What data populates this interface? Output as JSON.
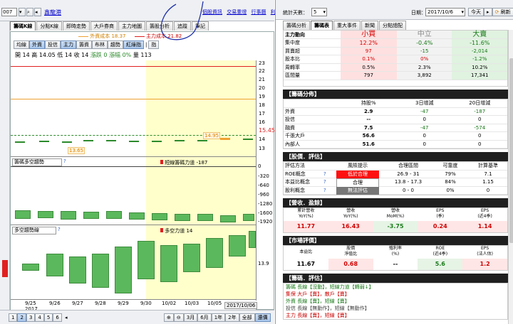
{
  "top_left": {
    "code": "007",
    "stock_name": "鑫龍港"
  },
  "chart_tabs": [
    "籌碼K線",
    "分點K線",
    "即時走勢",
    "大戶券商",
    "主力地圖",
    "籌股分析",
    "追蹤",
    "筆記"
  ],
  "header_links": [
    "個股資訊",
    "交易重燈",
    "行事曆",
    "利費通知"
  ],
  "avg_legend": {
    "foreign": "外資成本 18.37",
    "main": "主力成本 21.82"
  },
  "toolbar": [
    "均線",
    "外資",
    "投信",
    "主力",
    "籌資",
    "布林",
    "趨勢",
    "紅綠指",
    "|",
    "指"
  ],
  "ohlc": {
    "open": "開 14",
    "high": "高 14.05",
    "low": "低 14",
    "close": "收 14",
    "change": "漲跌 0",
    "pct": "漲幅 0%",
    "vol": "量 113"
  },
  "price_axis": {
    "ticks": [
      "23",
      "22",
      "21",
      "20",
      "19",
      "18",
      "17",
      "16",
      "15",
      "14",
      "13"
    ],
    "current": "15.45"
  },
  "candle_labels": {
    "high": "14.95",
    "low": "13.65"
  },
  "panel2": {
    "name": "籌碼多空趨勢",
    "legend": "短線籌碼力道 -187",
    "ticks": [
      "0",
      "-320",
      "-640",
      "-960",
      "-1280",
      "-1600",
      "-1920"
    ]
  },
  "panel3": {
    "name": "多空趨勢線",
    "legend": "多空力道 14",
    "ticks": [
      "13.9"
    ]
  },
  "x_axis": {
    "labels": [
      "9/25",
      "9/26",
      "9/27",
      "9/28",
      "9/29",
      "9/30",
      "10/02",
      "10/03",
      "10/05"
    ],
    "year": "2017",
    "selected_date": "2017/10/06"
  },
  "bottom_bar": {
    "pages": [
      "1",
      "2",
      "3",
      "4",
      "5",
      "6"
    ],
    "ranges": [
      "3月",
      "6月",
      "1年",
      "2年",
      "全部",
      "還價"
    ]
  },
  "right_top": {
    "stats_label": "統計天數：",
    "stats_value": "5",
    "date_label": "日期：",
    "date_value": "2017/10/6",
    "today_btn": "今天",
    "refresh_btn": "刷新"
  },
  "right_tabs": [
    "籌碼分析",
    "籌碼表",
    "重大事件",
    "新聞",
    "分點總配"
  ],
  "summary": {
    "cols": [
      "小買",
      "中立",
      "大賣"
    ],
    "rows": [
      {
        "label": "主力動向",
        "v": [
          "小買",
          "中立",
          "大賣"
        ]
      },
      {
        "label": "集中度",
        "v": [
          "12.2%",
          "-0.4%",
          "-11.6%"
        ]
      },
      {
        "label": "買賣超",
        "v": [
          "97",
          "-15",
          "-2,014"
        ]
      },
      {
        "label": "股本比",
        "v": [
          "0.1%",
          "0%",
          "-1.2%"
        ]
      },
      {
        "label": "周轉率",
        "v": [
          "0.5%",
          "2.3%",
          "10.2%"
        ]
      },
      {
        "label": "區間量",
        "v": [
          "797",
          "3,892",
          "17,341"
        ]
      }
    ]
  },
  "dist": {
    "title": "【籌碼分佈】",
    "head": [
      "",
      "持股%",
      "3日增減",
      "20日增減"
    ],
    "rows": [
      [
        "外資",
        "2.9",
        "-47",
        "-187"
      ],
      [
        "投信",
        "--",
        "0",
        "0"
      ],
      [
        "融資",
        "7.5",
        "-47",
        "-574"
      ],
      [
        "千張大戶",
        "56.6",
        "0",
        "0"
      ],
      [
        "內部人",
        "51.6",
        "0",
        "0"
      ]
    ]
  },
  "valuation": {
    "title": "【股價．評估】",
    "head": [
      "評估方法",
      "風險提示",
      "合理區間",
      "可靠度",
      "計算基準"
    ],
    "rows": [
      [
        "ROE概念",
        "低於合理",
        "26.9 - 31",
        "79%",
        "7.1"
      ],
      [
        "本益比概念",
        "合理",
        "13.8 - 17.3",
        "84%",
        "1.15"
      ],
      [
        "股利概念",
        "無法評估",
        "0 - 0",
        "0%",
        "0"
      ]
    ]
  },
  "revenue": {
    "title": "【營收．盈餘】",
    "head": [
      "累計營收\nYoY(%)",
      "營收\nYoY(%)",
      "營收\nMoM(%)",
      "EPS\n(季)",
      "EPS\n(近4季)"
    ],
    "vals": [
      "11.77",
      "16.43",
      "-3.75",
      "0.24",
      "1.14"
    ]
  },
  "market": {
    "title": "【市場評價】",
    "head": [
      "本益比",
      "股價\n淨值比",
      "殖利率\n(%)",
      "ROE\n(近4季)",
      "EPS\n(法人估)"
    ],
    "vals": [
      "11.67",
      "0.68",
      "--",
      "5.6",
      "1.2"
    ]
  },
  "evaluation": {
    "title": "【籌碼．評估】",
    "lines": [
      {
        "t": "籌碼 長線【沒動】，短線力道【轉弱↓】",
        "c": "#1a7a1a"
      },
      {
        "t": "集保 大戶【賣】，散戶【賣】",
        "c": "#cc0000"
      },
      {
        "t": "外資 長線【賣】，短線【賣】",
        "c": "#1a7a1a"
      },
      {
        "t": "投信 長線【無動作】，短線【無動作】",
        "c": "#444"
      },
      {
        "t": "主力 長線【賣】，短線【賣】",
        "c": "#cc0000"
      }
    ]
  },
  "colors": {
    "up": "#ff0000",
    "down": "#2c8a2c",
    "green_bar": "#5cb85c",
    "highlight": "#ffffcc"
  }
}
